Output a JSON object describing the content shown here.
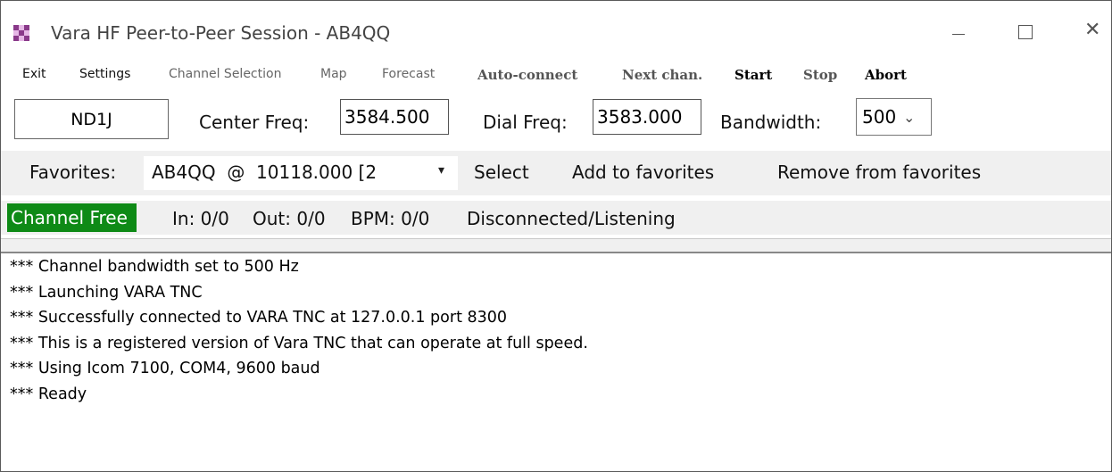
{
  "window": {
    "title": "Vara HF Peer-to-Peer Session - AB4QQ"
  },
  "menu": {
    "items": [
      {
        "label": "Exit"
      },
      {
        "label": "Settings"
      },
      {
        "label": "Channel Selection"
      },
      {
        "label": "Map"
      },
      {
        "label": "Forecast"
      },
      {
        "label": "Auto-connect"
      },
      {
        "label": "Next chan."
      },
      {
        "label": "Start"
      },
      {
        "label": "Stop"
      },
      {
        "label": "Abort"
      }
    ]
  },
  "connection": {
    "callsign": "ND1J",
    "center_freq_label": "Center Freq:",
    "center_freq_value": "3584.500",
    "dial_freq_label": "Dial Freq:",
    "dial_freq_value": "3583.000",
    "bandwidth_label": "Bandwidth:",
    "bandwidth_value": "500"
  },
  "favorites": {
    "label": "Favorites:",
    "selected": "AB4QQ  @  10118.000 [2",
    "select_label": "Select",
    "add_label": "Add to favorites",
    "remove_label": "Remove from favorites"
  },
  "status": {
    "channel": "Channel Free",
    "in": "In: 0/0",
    "out": "Out: 0/0",
    "bpm": "BPM: 0/0",
    "state": "Disconnected/Listening",
    "channel_color": "#0e8a16"
  },
  "log": {
    "lines": [
      "*** Channel bandwidth set to 500 Hz",
      "*** Launching VARA TNC",
      "*** Successfully connected to VARA TNC at 127.0.0.1 port 8300",
      "*** This is a registered version of Vara TNC that can operate at full speed.",
      "*** Using Icom 7100, COM4, 9600 baud",
      "*** Ready"
    ]
  },
  "icons": {
    "app": "checkerboard-app-icon",
    "minimize": "minimize-icon",
    "maximize": "maximize-icon",
    "close": "close-icon",
    "dropdown": "chevron-down-icon"
  }
}
